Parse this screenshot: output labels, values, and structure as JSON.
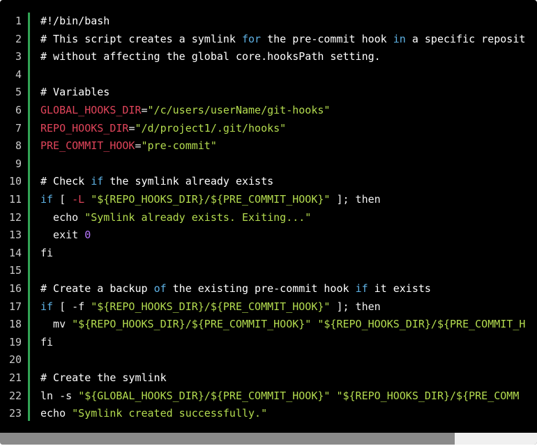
{
  "code": {
    "lines": [
      {
        "n": "1",
        "tokens": [
          {
            "t": "#!/bin/bash",
            "c": "comment"
          }
        ]
      },
      {
        "n": "2",
        "tokens": [
          {
            "t": "# This script creates a symlink ",
            "c": "comment"
          },
          {
            "t": "for",
            "c": "kw"
          },
          {
            "t": " the pre-commit hook ",
            "c": "comment"
          },
          {
            "t": "in",
            "c": "kw"
          },
          {
            "t": " a specific reposit",
            "c": "comment"
          }
        ]
      },
      {
        "n": "3",
        "tokens": [
          {
            "t": "# without affecting the global core.hooksPath setting.",
            "c": "comment"
          }
        ]
      },
      {
        "n": "4",
        "tokens": []
      },
      {
        "n": "5",
        "tokens": [
          {
            "t": "# Variables",
            "c": "comment"
          }
        ]
      },
      {
        "n": "6",
        "tokens": [
          {
            "t": "GLOBAL_HOOKS_DIR",
            "c": "var"
          },
          {
            "t": "=",
            "c": "op"
          },
          {
            "t": "\"/c/users/userName/git-hooks\"",
            "c": "str"
          }
        ]
      },
      {
        "n": "7",
        "tokens": [
          {
            "t": "REPO_HOOKS_DIR",
            "c": "var"
          },
          {
            "t": "=",
            "c": "op"
          },
          {
            "t": "\"/d/project1/.git/hooks\"",
            "c": "str"
          }
        ]
      },
      {
        "n": "8",
        "tokens": [
          {
            "t": "PRE_COMMIT_HOOK",
            "c": "var"
          },
          {
            "t": "=",
            "c": "op"
          },
          {
            "t": "\"pre-commit\"",
            "c": "str"
          }
        ]
      },
      {
        "n": "9",
        "tokens": []
      },
      {
        "n": "10",
        "tokens": [
          {
            "t": "# Check ",
            "c": "comment"
          },
          {
            "t": "if",
            "c": "kw"
          },
          {
            "t": " the symlink already exists",
            "c": "comment"
          }
        ]
      },
      {
        "n": "11",
        "tokens": [
          {
            "t": "if",
            "c": "kw"
          },
          {
            "t": " [ ",
            "c": "plain"
          },
          {
            "t": "-L",
            "c": "var"
          },
          {
            "t": " ",
            "c": "plain"
          },
          {
            "t": "\"${REPO_HOOKS_DIR}/${PRE_COMMIT_HOOK}\"",
            "c": "str"
          },
          {
            "t": " ]; then",
            "c": "plain"
          }
        ]
      },
      {
        "n": "12",
        "tokens": [
          {
            "t": "  echo ",
            "c": "plain"
          },
          {
            "t": "\"Symlink already exists. Exiting...\"",
            "c": "str"
          }
        ]
      },
      {
        "n": "13",
        "tokens": [
          {
            "t": "  exit ",
            "c": "plain"
          },
          {
            "t": "0",
            "c": "num"
          }
        ]
      },
      {
        "n": "14",
        "tokens": [
          {
            "t": "fi",
            "c": "plain"
          }
        ]
      },
      {
        "n": "15",
        "tokens": []
      },
      {
        "n": "16",
        "tokens": [
          {
            "t": "# Create a backup ",
            "c": "comment"
          },
          {
            "t": "of",
            "c": "kw"
          },
          {
            "t": " the existing pre-commit hook ",
            "c": "comment"
          },
          {
            "t": "if",
            "c": "kw"
          },
          {
            "t": " it exists",
            "c": "comment"
          }
        ]
      },
      {
        "n": "17",
        "tokens": [
          {
            "t": "if",
            "c": "kw"
          },
          {
            "t": " [ -f ",
            "c": "plain"
          },
          {
            "t": "\"${REPO_HOOKS_DIR}/${PRE_COMMIT_HOOK}\"",
            "c": "str"
          },
          {
            "t": " ]; then",
            "c": "plain"
          }
        ]
      },
      {
        "n": "18",
        "tokens": [
          {
            "t": "  mv ",
            "c": "plain"
          },
          {
            "t": "\"${REPO_HOOKS_DIR}/${PRE_COMMIT_HOOK}\"",
            "c": "str"
          },
          {
            "t": " ",
            "c": "plain"
          },
          {
            "t": "\"${REPO_HOOKS_DIR}/${PRE_COMMIT_H",
            "c": "str"
          }
        ]
      },
      {
        "n": "19",
        "tokens": [
          {
            "t": "fi",
            "c": "plain"
          }
        ]
      },
      {
        "n": "20",
        "tokens": []
      },
      {
        "n": "21",
        "tokens": [
          {
            "t": "# Create the symlink",
            "c": "comment"
          }
        ]
      },
      {
        "n": "22",
        "tokens": [
          {
            "t": "ln -s ",
            "c": "plain"
          },
          {
            "t": "\"${GLOBAL_HOOKS_DIR}/${PRE_COMMIT_HOOK}\"",
            "c": "str"
          },
          {
            "t": " ",
            "c": "plain"
          },
          {
            "t": "\"${REPO_HOOKS_DIR}/${PRE_COMM",
            "c": "str"
          }
        ]
      },
      {
        "n": "23",
        "tokens": [
          {
            "t": "echo ",
            "c": "plain"
          },
          {
            "t": "\"Symlink created successfully.\"",
            "c": "str"
          }
        ]
      }
    ]
  },
  "colors": {
    "background": "#000000",
    "gutter_border": "#31a354",
    "keyword": "#5fb3e6",
    "variable": "#e0445a",
    "string": "#b4dc4f",
    "number": "#b877ff"
  }
}
